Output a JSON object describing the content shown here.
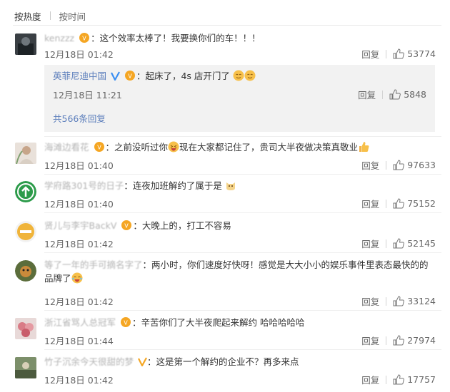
{
  "sort": {
    "hot": "按热度",
    "time": "按时间"
  },
  "comments": [
    {
      "user": "kenzzz",
      "text": "：这个效率太棒了！我要换你们的车！！！",
      "date": "12月18日 01:42",
      "reply": "回复",
      "likes": "53774"
    },
    {
      "user": "海滩边看花",
      "text_a": "：之前没听过你",
      "text_b": "现在大家都记住了，贵司大半夜做决策真敬业",
      "date": "12月18日 01:40",
      "reply": "回复",
      "likes": "97633"
    },
    {
      "user": "学府路301号的日子",
      "text": "：连夜加班解约了属于是",
      "date": "12月18日 01:40",
      "reply": "回复",
      "likes": "75152"
    },
    {
      "user": "贤儿与李宇BackV",
      "text": "：大晚上的，打工不容易",
      "date": "12月18日 01:42",
      "reply": "回复",
      "likes": "52145"
    },
    {
      "user": "等了一年的手可摘名字了",
      "text_a": "：两小时，你们速度好快呀！感觉是大大小小的娱乐事件里表态最快的的",
      "text_b": "品牌了",
      "date": "12月18日 01:42",
      "reply": "回复",
      "likes": "33124"
    },
    {
      "user": "浙江省骂人总冠军",
      "text": "：辛苦你们了大半夜爬起来解约 哈哈哈哈哈",
      "date": "12月18日 01:44",
      "reply": "回复",
      "likes": "27974"
    },
    {
      "user": "竹子沉余今天很甜的梦",
      "text": "：这是第一个解约的企业不？再多来点",
      "date": "12月18日 01:42",
      "reply": "回复",
      "likes": "17757"
    }
  ],
  "official_reply": {
    "name": "英菲尼迪中国",
    "text": "：起床了，4s 店开门了",
    "date": "12月18日 11:21",
    "reply": "回复",
    "likes": "5848",
    "more": "共566条回复"
  },
  "colors": {
    "link": "#5d7fbc",
    "muted": "#666666",
    "reply_bg": "#f2f2f2"
  },
  "icons": [
    "thumb-up-icon",
    "vip-badge-icon",
    "verified-v-icon",
    "emoji-icon"
  ]
}
